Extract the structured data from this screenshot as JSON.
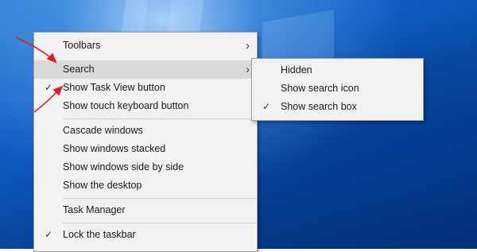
{
  "menu": {
    "toolbars": "Toolbars",
    "search": "Search",
    "show_task_view": "Show Task View button",
    "show_touch_keyboard": "Show touch keyboard button",
    "cascade": "Cascade windows",
    "stacked": "Show windows stacked",
    "side_by_side": "Show windows side by side",
    "show_desktop": "Show the desktop",
    "task_manager": "Task Manager",
    "lock_taskbar": "Lock the taskbar"
  },
  "submenu": {
    "hidden": "Hidden",
    "show_icon": "Show search icon",
    "show_box": "Show search box"
  },
  "checked": [
    "show_task_view",
    "lock_taskbar",
    "show_box"
  ],
  "colors": {
    "menu_bg": "#f2f2f2",
    "highlight": "#dadada",
    "annotation_arrow": "#e01e1e"
  },
  "icons": [
    "checkmark-icon",
    "chevron-right-icon"
  ]
}
